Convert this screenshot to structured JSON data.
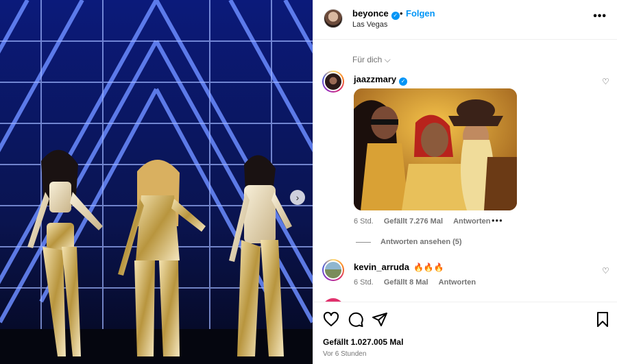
{
  "header": {
    "username": "beyonce",
    "separator": "•",
    "follow_label": "Folgen",
    "location": "Las Vegas",
    "more_label": "•••"
  },
  "comments_filter": {
    "label": "Für dich ⌵"
  },
  "comments": [
    {
      "username": "jaazzmary",
      "verified": true,
      "time": "6 Std.",
      "likes": "Gefällt 7.276 Mal",
      "reply_label": "Antworten",
      "options_label": "•••",
      "view_replies": "Antworten ansehen (5)"
    },
    {
      "username": "kevin_arruda",
      "text": "🔥🔥🔥",
      "time": "6 Std.",
      "likes": "Gefällt 8 Mal",
      "reply_label": "Antworten"
    }
  ],
  "icons": {
    "heart_small": "♡",
    "verified": "✓",
    "next": "›"
  },
  "post": {
    "likes_total": "Gefällt 1.027.005 Mal",
    "time_ago": "Vor 6 Stunden"
  },
  "colors": {
    "accent": "#0095f6",
    "muted": "#737373",
    "stage_blue": "#1d3bd8"
  }
}
